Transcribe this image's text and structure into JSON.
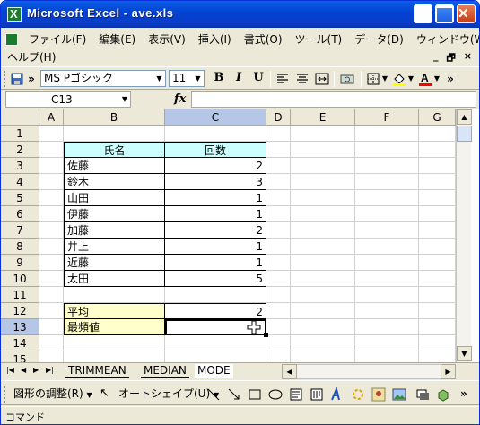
{
  "window": {
    "title": "Microsoft Excel - ave.xls"
  },
  "menu": {
    "items": [
      "ファイル(F)",
      "編集(E)",
      "表示(V)",
      "挿入(I)",
      "書式(O)",
      "ツール(T)",
      "データ(D)",
      "ウィンドウ(W)"
    ],
    "help": "ヘルプ(H)",
    "doc_controls": [
      "_",
      "🗗",
      "×"
    ]
  },
  "toolbar": {
    "font_name": "MS Pゴシック",
    "font_size": "11",
    "bold": "B",
    "italic": "I",
    "underline": "U",
    "chevron": "»"
  },
  "formula_bar": {
    "name_box": "C13",
    "fx": "fx",
    "value": ""
  },
  "grid": {
    "columns": [
      "A",
      "B",
      "C",
      "D",
      "E",
      "F",
      "G"
    ],
    "selected_column": "C",
    "rows": [
      "1",
      "2",
      "3",
      "4",
      "5",
      "6",
      "7",
      "8",
      "9",
      "10",
      "11",
      "12",
      "13",
      "14",
      "15"
    ],
    "selected_row": "13",
    "table_header": {
      "name": "氏名",
      "count": "回数"
    },
    "table_rows": [
      {
        "name": "佐藤",
        "count": "2"
      },
      {
        "name": "鈴木",
        "count": "3"
      },
      {
        "name": "山田",
        "count": "1"
      },
      {
        "name": "伊藤",
        "count": "1"
      },
      {
        "name": "加藤",
        "count": "2"
      },
      {
        "name": "井上",
        "count": "1"
      },
      {
        "name": "近藤",
        "count": "1"
      },
      {
        "name": "太田",
        "count": "5"
      }
    ],
    "average": {
      "label": "平均",
      "value": "2"
    },
    "mode": {
      "label": "最頻値",
      "value": ""
    }
  },
  "sheet_tabs": [
    "TRIMMEAN",
    "MEDIAN",
    "MODE"
  ],
  "active_sheet": "MODE",
  "drawing_toolbar": {
    "adjust": "図形の調整(R)",
    "autoshape": "オートシェイプ(U)"
  },
  "status": {
    "text": "コマンド"
  }
}
